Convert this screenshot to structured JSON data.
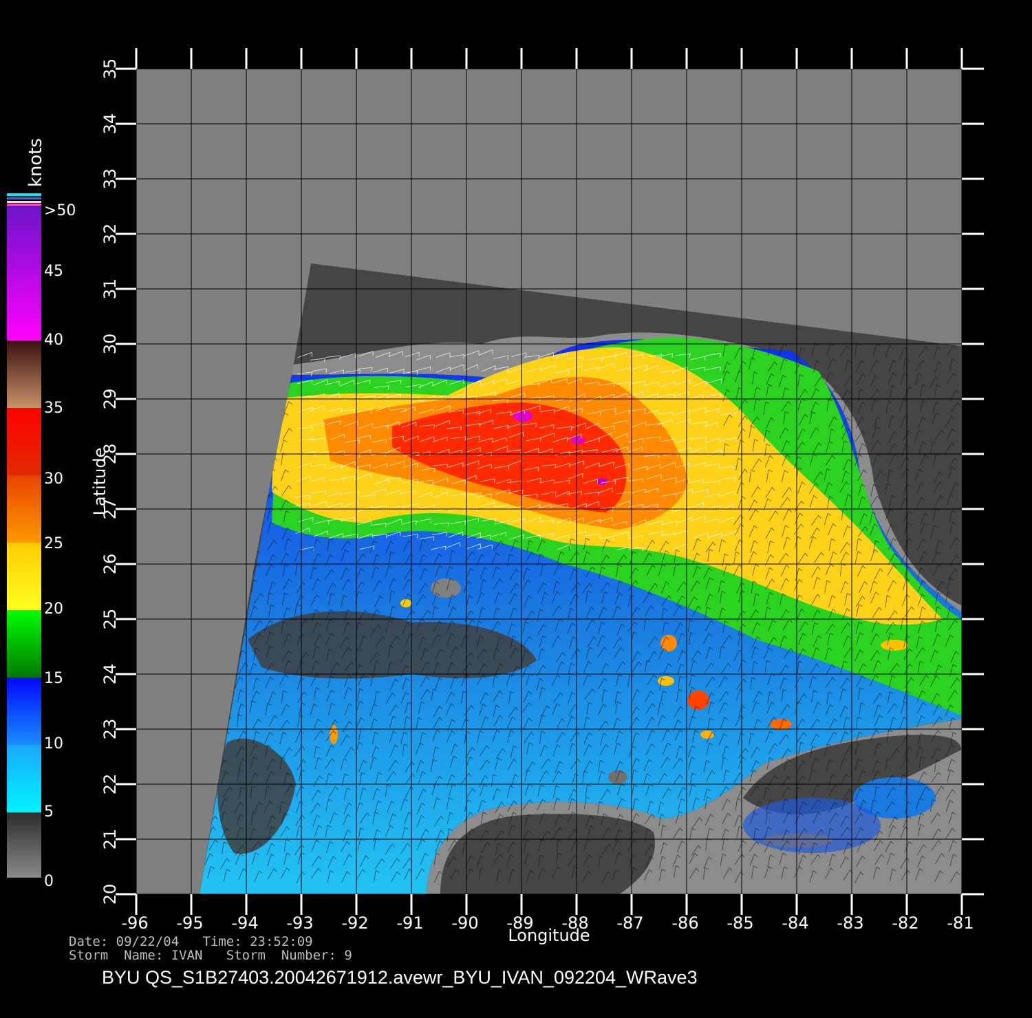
{
  "map": {
    "x_label": "Longitude",
    "y_label": "Latitude",
    "lon_range": [
      -96,
      -81
    ],
    "lat_range": [
      20,
      35
    ],
    "lon_ticks": [
      "-96",
      "-95",
      "-94",
      "-93",
      "-92",
      "-91",
      "-90",
      "-89",
      "-88",
      "-87",
      "-86",
      "-85",
      "-84",
      "-83",
      "-82",
      "-81"
    ],
    "lat_ticks": [
      "20",
      "21",
      "22",
      "23",
      "24",
      "25",
      "26",
      "27",
      "28",
      "29",
      "30",
      "31",
      "32",
      "33",
      "34",
      "35"
    ],
    "grid": true
  },
  "colorbar": {
    "unit": "knots",
    "labels": [
      ">50",
      "45",
      "40",
      "35",
      "30",
      "25",
      "20",
      "15",
      "10",
      "5",
      "0"
    ]
  },
  "info": {
    "date_line": "Date: 09/22/04   Time: 23:52:09",
    "storm_line": "Storm  Name: IVAN   Storm  Number: 9"
  },
  "title": "BYU  QS_S1B27403.20042671912.avewr_BYU_IVAN_092204_WRave3",
  "colors": {
    "background": "#000000",
    "no_data": "#808080",
    "land": "#454545",
    "coast": "#8c8c8c",
    "grid": "#000000"
  }
}
